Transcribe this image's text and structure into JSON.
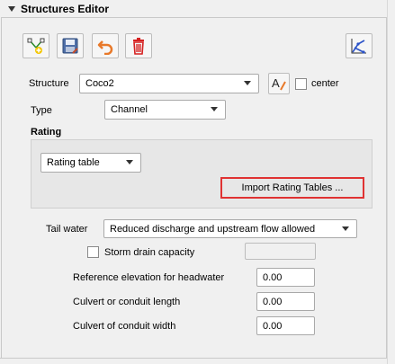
{
  "panel": {
    "title": "Structures Editor"
  },
  "toolbar": {
    "buttons": [
      {
        "icon": "add-structure-icon",
        "tooltip": ""
      },
      {
        "icon": "save-icon"
      },
      {
        "icon": "undo-arrow-icon"
      },
      {
        "icon": "delete-trash-icon"
      },
      {
        "icon": "schematize-icon"
      }
    ]
  },
  "form": {
    "structure_label": "Structure",
    "structure_value": "Coco2",
    "center_label": "center",
    "type_label": "Type",
    "type_value": "Channel",
    "rating_label": "Rating",
    "rating_value": "Rating table",
    "import_button": "Import Rating Tables ...",
    "tailwater_label": "Tail water",
    "tailwater_value": "Reduced discharge and upstream flow allowed",
    "storm_drain_label": "Storm drain capacity",
    "ref_elev_label": "Reference elevation for headwater",
    "ref_elev_value": "0.00",
    "culvert_length_label": "Culvert or conduit length",
    "culvert_length_value": "0.00",
    "culvert_width_label": "Culvert of conduit width",
    "culvert_width_value": "0.00"
  },
  "colors": {
    "highlight": "#e03232",
    "trash_red": "#d62020",
    "undo_orange": "#e8792a"
  }
}
